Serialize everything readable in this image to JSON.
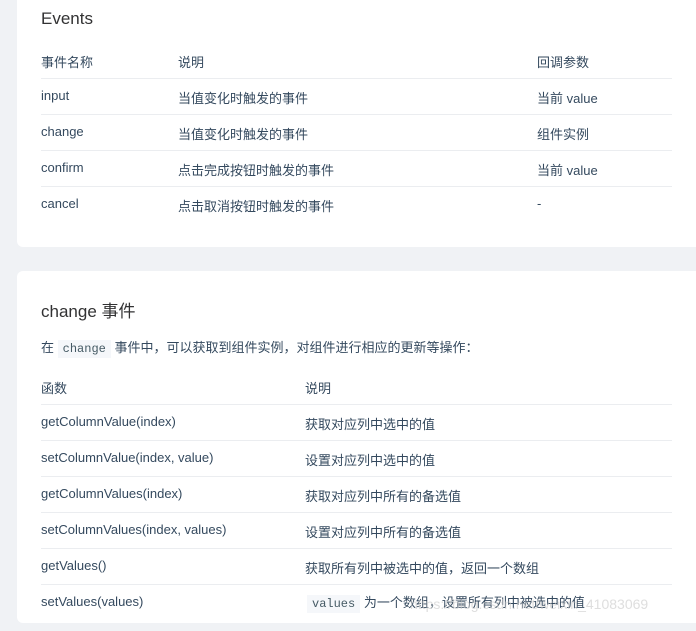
{
  "events": {
    "title": "Events",
    "headers": [
      "事件名称",
      "说明",
      "回调参数"
    ],
    "rows": [
      [
        "input",
        "当值变化时触发的事件",
        "当前 value"
      ],
      [
        "change",
        "当值变化时触发的事件",
        "组件实例"
      ],
      [
        "confirm",
        "点击完成按钮时触发的事件",
        "当前 value"
      ],
      [
        "cancel",
        "点击取消按钮时触发的事件",
        "-"
      ]
    ]
  },
  "change_event": {
    "title": "change 事件",
    "desc_prefix": "在",
    "desc_code": "change",
    "desc_suffix": "事件中，可以获取到组件实例，对组件进行相应的更新等操作：",
    "headers": [
      "函数",
      "说明"
    ],
    "rows": [
      [
        "getColumnValue(index)",
        "获取对应列中选中的值"
      ],
      [
        "setColumnValue(index, value)",
        "设置对应列中选中的值"
      ],
      [
        "getColumnValues(index)",
        "获取对应列中所有的备选值"
      ],
      [
        "setColumnValues(index, values)",
        "设置对应列中所有的备选值"
      ],
      [
        "getValues()",
        "获取所有列中被选中的值，返回一个数组"
      ]
    ],
    "last_row": {
      "fn": "setValues(values)",
      "code": "values",
      "text": "为一个数组，设置所有列中被选中的值"
    }
  },
  "watermark": "https://blog.csdn.net/weixin_41083069"
}
